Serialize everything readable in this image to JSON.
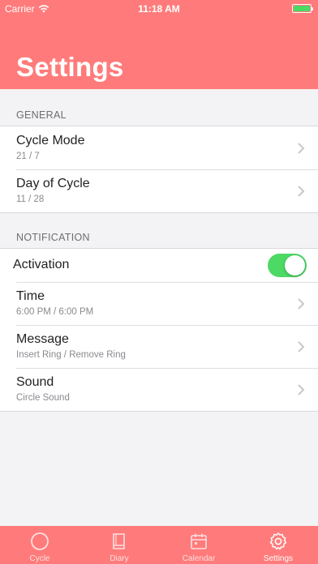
{
  "status_bar": {
    "carrier": "Carrier",
    "time": "11:18 AM"
  },
  "header": {
    "title": "Settings"
  },
  "general": {
    "header": "GENERAL",
    "items": [
      {
        "title": "Cycle Mode",
        "subtitle": "21 / 7"
      },
      {
        "title": "Day of Cycle",
        "subtitle": "11 / 28"
      }
    ]
  },
  "notification": {
    "header": "NOTIFICATION",
    "activation": {
      "label": "Activation",
      "on": true
    },
    "items": [
      {
        "title": "Time",
        "subtitle": "6:00 PM / 6:00 PM"
      },
      {
        "title": "Message",
        "subtitle": "Insert Ring / Remove Ring"
      },
      {
        "title": "Sound",
        "subtitle": "Circle Sound"
      }
    ]
  },
  "tabs": [
    {
      "label": "Cycle",
      "icon": "circle-icon"
    },
    {
      "label": "Diary",
      "icon": "book-icon"
    },
    {
      "label": "Calendar",
      "icon": "calendar-icon"
    },
    {
      "label": "Settings",
      "icon": "gear-icon",
      "active": true
    }
  ],
  "colors": {
    "accent": "#ff7b7b",
    "toggle_on": "#4cd964"
  }
}
